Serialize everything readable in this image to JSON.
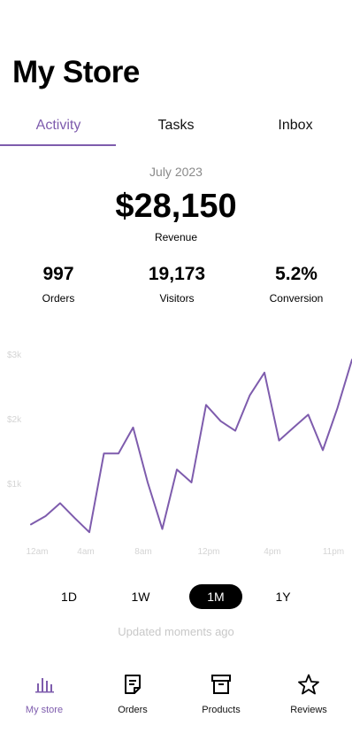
{
  "header": {
    "title": "My Store"
  },
  "tabs": [
    {
      "label": "Activity",
      "active": true
    },
    {
      "label": "Tasks",
      "active": false
    },
    {
      "label": "Inbox",
      "active": false
    }
  ],
  "summary": {
    "period": "July 2023",
    "revenue": "$28,150",
    "revenue_label": "Revenue",
    "stats": [
      {
        "value": "997",
        "label": "Orders"
      },
      {
        "value": "19,173",
        "label": "Visitors"
      },
      {
        "value": "5.2%",
        "label": "Conversion"
      }
    ]
  },
  "chart_data": {
    "type": "line",
    "title": "",
    "color": "#7e5cad",
    "y_ticks": [
      "$1k",
      "$2k",
      "$3k"
    ],
    "x_ticks": [
      "12am",
      "4am",
      "8am",
      "12pm",
      "4pm",
      "11pm"
    ],
    "ylim": [
      0,
      3000
    ],
    "series": [
      {
        "values": [
          350,
          480,
          680,
          450,
          230,
          1450,
          1450,
          1850,
          1000,
          280,
          1200,
          1000,
          2200,
          1950,
          1800,
          2350,
          2700,
          1650,
          1850,
          2050,
          1500,
          2150,
          2900
        ]
      }
    ]
  },
  "ranges": [
    {
      "label": "1D",
      "active": false
    },
    {
      "label": "1W",
      "active": false
    },
    {
      "label": "1M",
      "active": true
    },
    {
      "label": "1Y",
      "active": false
    }
  ],
  "updated_text": "Updated moments ago",
  "nav": [
    {
      "label": "My store",
      "icon": "bar-chart-icon",
      "active": true
    },
    {
      "label": "Orders",
      "icon": "document-icon",
      "active": false
    },
    {
      "label": "Products",
      "icon": "archive-box-icon",
      "active": false
    },
    {
      "label": "Reviews",
      "icon": "star-icon",
      "active": false
    }
  ]
}
